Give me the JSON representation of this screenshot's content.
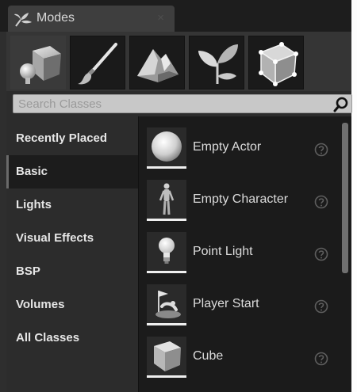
{
  "tab": {
    "title": "Modes",
    "close": "×",
    "icon": "modes-leaf-icon"
  },
  "mode_buttons": [
    {
      "name": "place-mode",
      "icon": "place-cube-icon",
      "active": true
    },
    {
      "name": "paint-mode",
      "icon": "paintbrush-icon",
      "active": false
    },
    {
      "name": "landscape-mode",
      "icon": "landscape-mountain-icon",
      "active": false
    },
    {
      "name": "foliage-mode",
      "icon": "foliage-leaf-icon",
      "active": false
    },
    {
      "name": "geometry-mode",
      "icon": "geometry-box-icon",
      "active": false
    }
  ],
  "search": {
    "placeholder": "Search Classes",
    "value": "",
    "icon": "search-icon"
  },
  "categories": [
    {
      "label": "Recently Placed",
      "active": false
    },
    {
      "label": "Basic",
      "active": true
    },
    {
      "label": "Lights",
      "active": false
    },
    {
      "label": "Visual Effects",
      "active": false
    },
    {
      "label": "BSP",
      "active": false
    },
    {
      "label": "Volumes",
      "active": false
    },
    {
      "label": "All Classes",
      "active": false
    }
  ],
  "items": [
    {
      "label": "Empty Actor",
      "icon": "sphere-icon"
    },
    {
      "label": "Empty Character",
      "icon": "character-icon"
    },
    {
      "label": "Point Light",
      "icon": "lightbulb-icon"
    },
    {
      "label": "Player Start",
      "icon": "player-start-icon"
    },
    {
      "label": "Cube",
      "icon": "cube-icon"
    }
  ],
  "colors": {
    "panel": "#2e2e2e",
    "list_background": "#1b1b1b",
    "text": "#e6e6e6"
  }
}
